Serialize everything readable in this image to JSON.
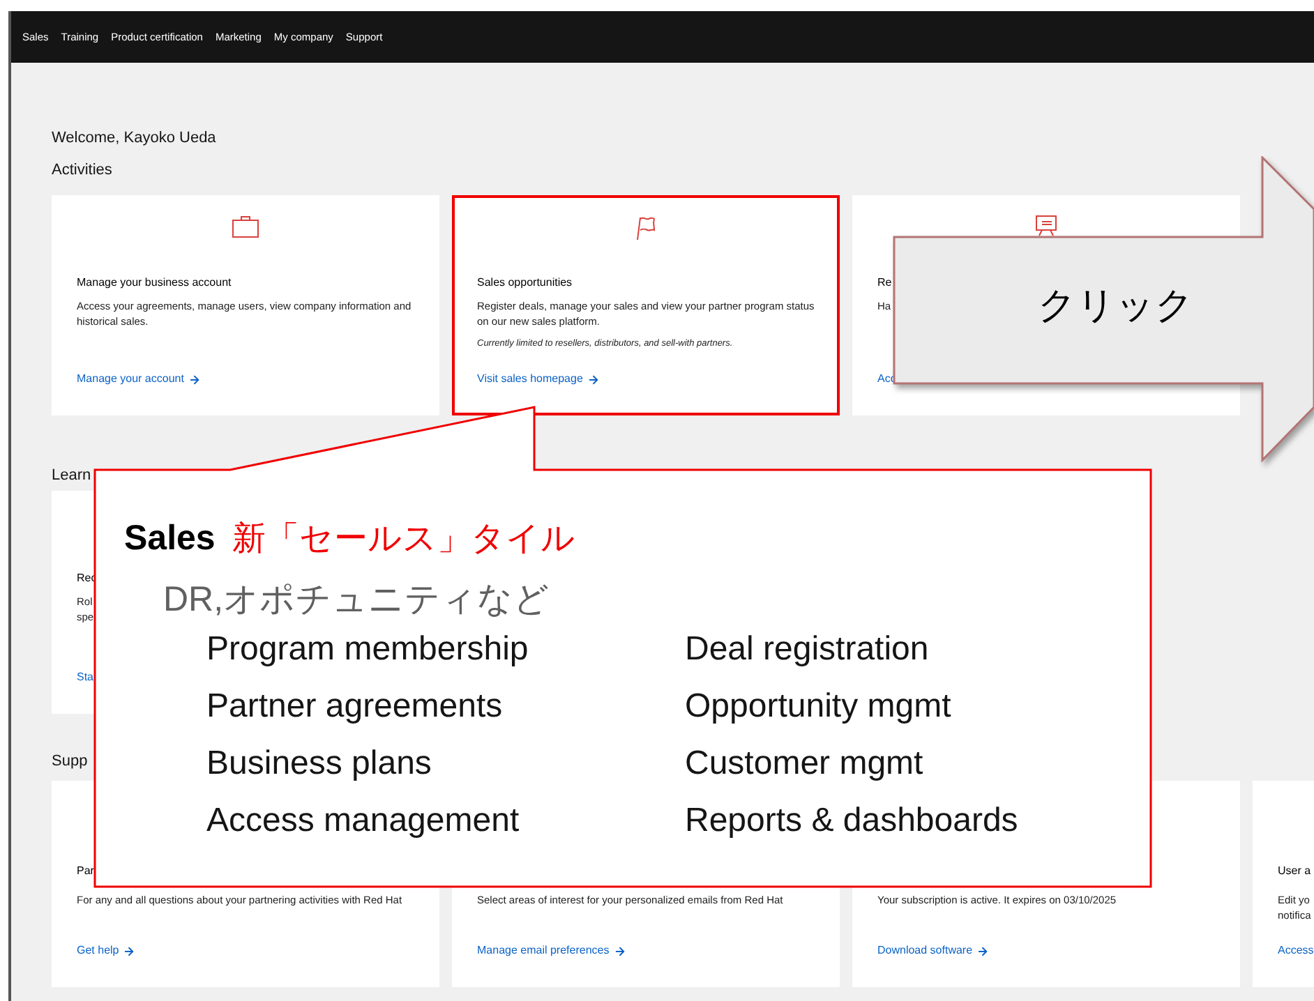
{
  "nav": {
    "items": [
      "Sales",
      "Training",
      "Product certification",
      "Marketing",
      "My company",
      "Support"
    ]
  },
  "welcome": "Welcome, Kayoko Ueda",
  "activities": {
    "heading": "Activities",
    "cards": [
      {
        "title": "Manage your business account",
        "description": "Access your agreements, manage users, view company information and historical sales.",
        "link": "Manage your account",
        "arrow": true,
        "highlighted": false
      },
      {
        "title": "Sales opportunities",
        "description": "Register deals, manage your sales and view your partner program status on our new sales platform.",
        "note": "Currently limited to resellers, distributors, and sell-with partners.",
        "link": "Visit sales homepage",
        "arrow": true,
        "highlighted": true
      },
      {
        "title": "Re",
        "description": "Ha",
        "link": "Acc",
        "highlighted": false
      }
    ]
  },
  "learning": {
    "heading": "Learn",
    "cards": [
      {
        "title": "Rec",
        "description_lines": [
          "Rol",
          "spe"
        ],
        "link": "Sta"
      }
    ]
  },
  "support": {
    "heading": "Supp",
    "cards": [
      {
        "title": "Par",
        "description": "For any and all questions about your partnering activities with Red Hat",
        "link": "Get help",
        "arrow": true
      },
      {
        "description": "Select areas of interest for your personalized emails from Red Hat",
        "link": "Manage email preferences",
        "arrow": true
      },
      {
        "description": "Your subscription is active. It expires on 03/10/2025",
        "link": "Download software",
        "arrow": true
      },
      {
        "title": "User a",
        "description_lines": [
          "Edit yo",
          "notifica"
        ],
        "link": "Access"
      }
    ]
  },
  "callout": {
    "title": "Sales",
    "tag": "新「セールス」タイル",
    "subtitle": "DR,オポチュニティなど",
    "columns": [
      [
        "Program membership",
        "Partner agreements",
        "Business plans",
        "Access management"
      ],
      [
        "Deal registration",
        "Opportunity mgmt",
        "Customer mgmt",
        "Reports & dashboards"
      ]
    ]
  },
  "click_arrow": {
    "label": "クリック"
  }
}
